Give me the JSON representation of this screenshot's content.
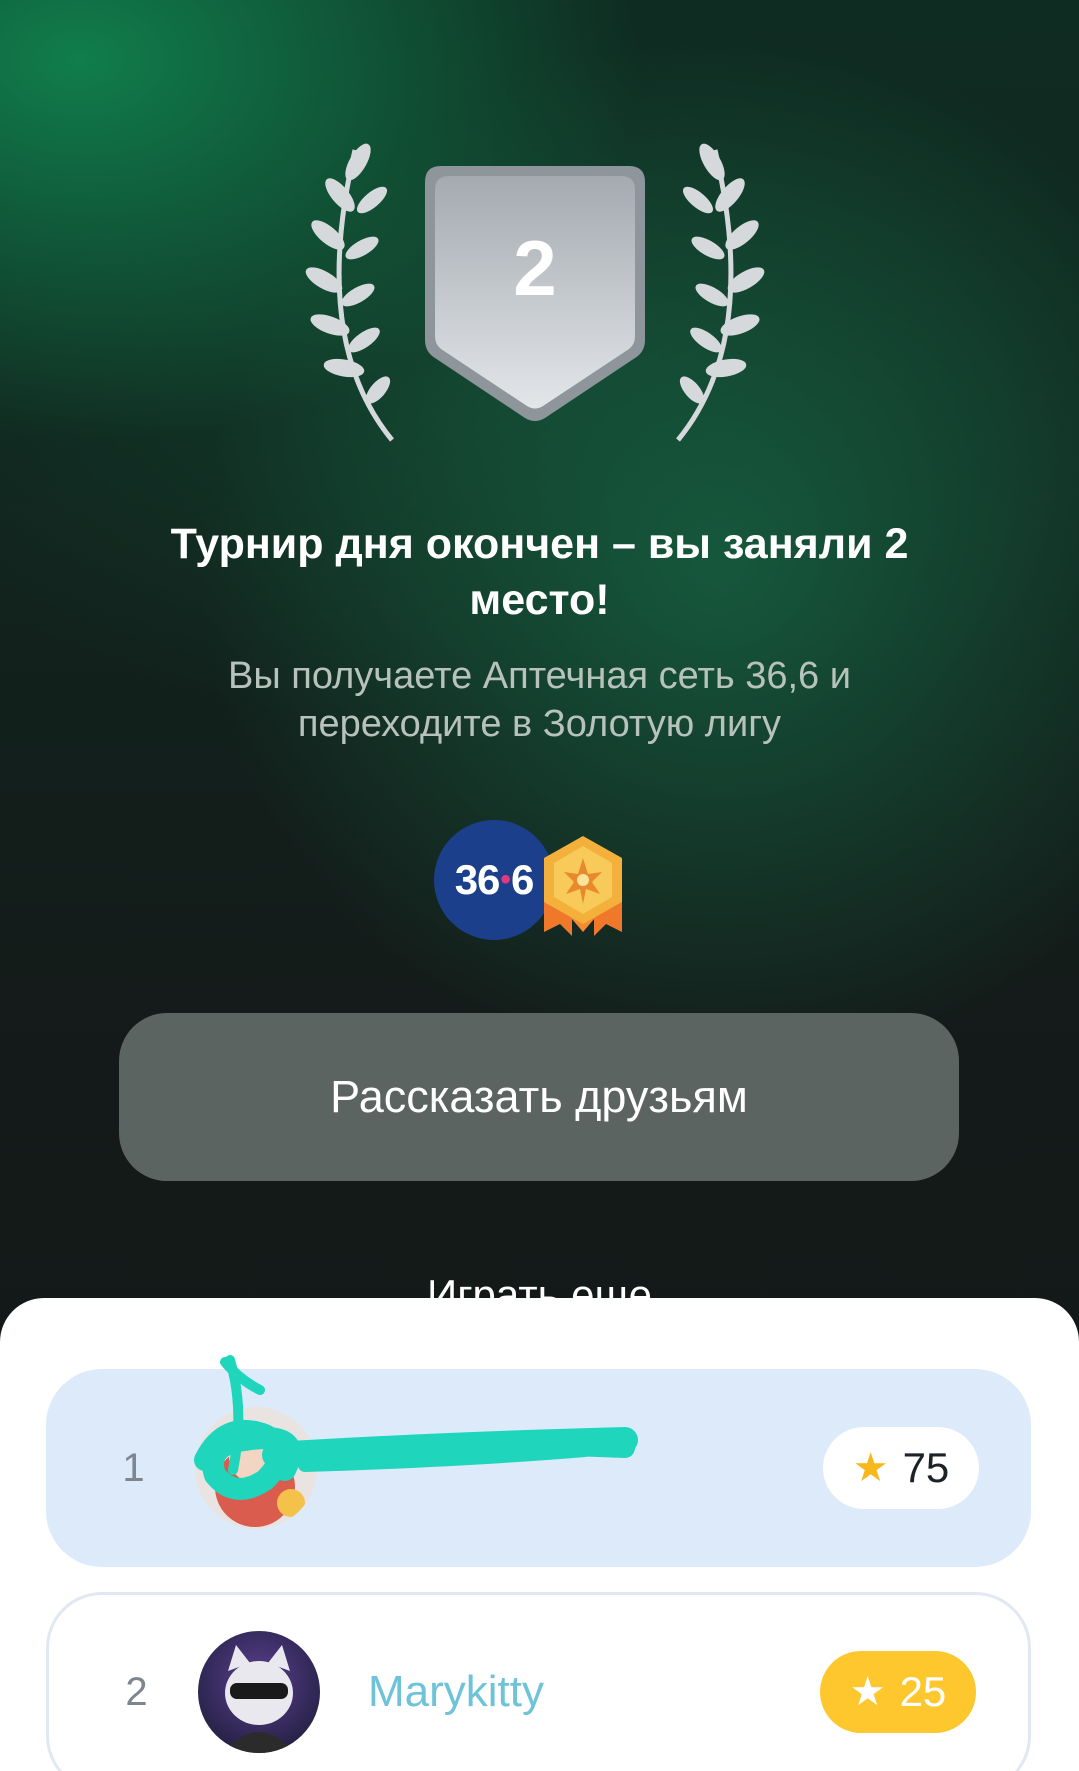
{
  "result": {
    "place_number": "2",
    "title": "Турнир дня окончен – вы заняли 2 место!",
    "subtitle": "Вы получаете Аптечная сеть 36,6 и переходите в Золотую лигу"
  },
  "rewards": {
    "partner_logo_text_left": "36",
    "partner_logo_text_right": "6",
    "league_badge_icon": "gold-league-badge-icon"
  },
  "actions": {
    "share_label": "Рассказать друзьям",
    "play_more_label": "Играть еще"
  },
  "leaderboard": [
    {
      "rank": "1",
      "name": "",
      "score": "75",
      "highlight": true
    },
    {
      "rank": "2",
      "name": "Marykitty",
      "score": "25",
      "highlight": false
    }
  ],
  "colors": {
    "accent_green": "#10824e",
    "share_button_bg": "#5c6461",
    "own_row_bg": "#dceafa",
    "score_badge_yellow": "#ffc72e",
    "player_name": "#6fc3d9",
    "redaction": "#1fd6bd"
  }
}
